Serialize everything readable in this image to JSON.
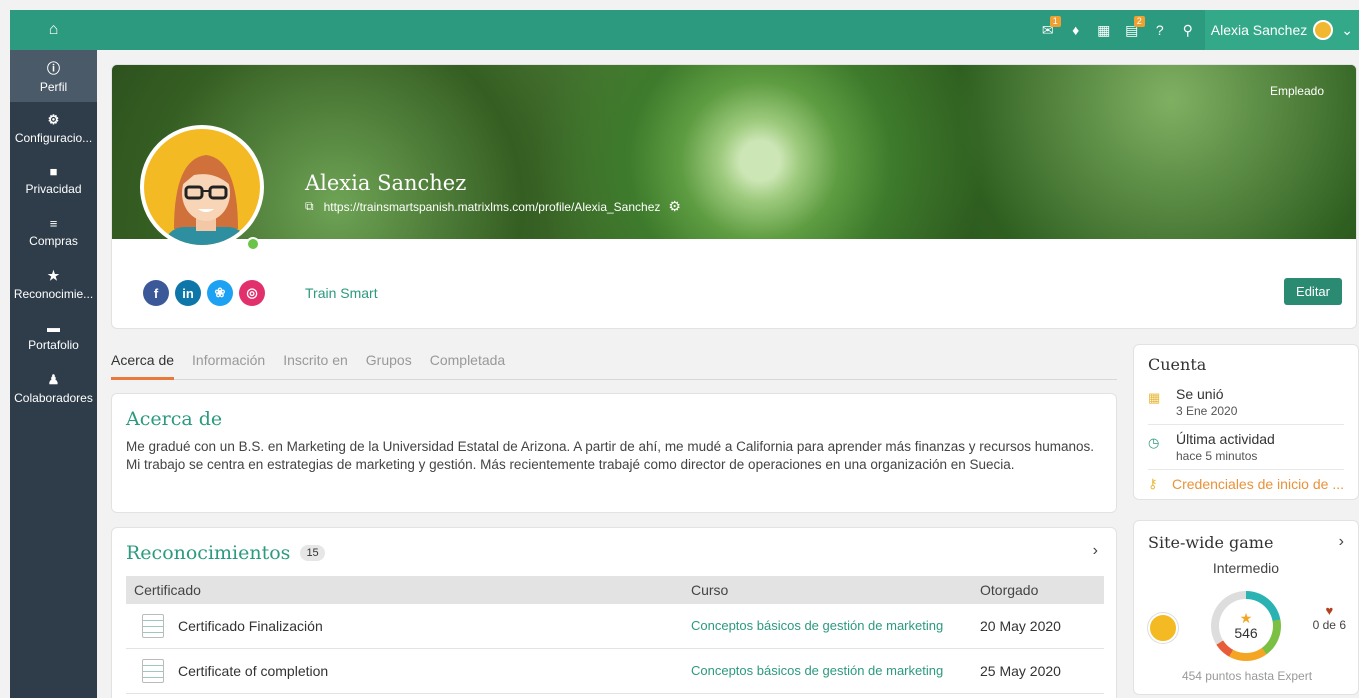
{
  "topbar": {
    "user_name": "Alexia Sanchez",
    "badges": {
      "inbox": "1",
      "cart": "2"
    }
  },
  "sidebar": {
    "items": [
      {
        "label": "Perfil",
        "icon": "info-icon"
      },
      {
        "label": "Configuracio...",
        "icon": "gear-icon"
      },
      {
        "label": "Privacidad",
        "icon": "lock-icon"
      },
      {
        "label": "Compras",
        "icon": "receipt-icon"
      },
      {
        "label": "Reconocimie...",
        "icon": "star-icon"
      },
      {
        "label": "Portafolio",
        "icon": "folder-icon"
      },
      {
        "label": "Colaboradores",
        "icon": "users-icon"
      }
    ]
  },
  "profile": {
    "cover_tag": "Empleado",
    "name": "Alexia Sanchez",
    "url": "https://trainsmartspanish.matrixlms.com/profile/Alexia_Sanchez",
    "organization": "Train Smart",
    "edit_label": "Editar"
  },
  "tabs": [
    "Acerca de",
    "Información",
    "Inscrito en",
    "Grupos",
    "Completada"
  ],
  "about": {
    "title": "Acerca de",
    "text": "Me gradué con un B.S. en Marketing de la Universidad Estatal de Arizona. A partir de ahí, me mudé a California para aprender más finanzas y recursos humanos. Mi trabajo se centra en estrategias de marketing y gestión. Más recientemente trabajé como director de operaciones en una organización en Suecia."
  },
  "recognitions": {
    "title": "Reconocimientos",
    "count": "15",
    "columns": [
      "Certificado",
      "Curso",
      "Otorgado"
    ],
    "rows": [
      {
        "certificate": "Certificado Finalización",
        "course": "Conceptos básicos de gestión de marketing",
        "date": "20 May 2020"
      },
      {
        "certificate": "Certificate of completion",
        "course": "Conceptos básicos de gestión de marketing",
        "date": "25 May 2020"
      }
    ]
  },
  "account": {
    "title": "Cuenta",
    "joined_label": "Se unió",
    "joined_value": "3 Ene 2020",
    "activity_label": "Última actividad",
    "activity_value": "hace 5 minutos",
    "credentials_link": "Credenciales de inicio de ..."
  },
  "game": {
    "title": "Site-wide game",
    "level": "Intermedio",
    "points": "546",
    "badges": "0 de 6",
    "to_next": "454 puntos hasta Expert"
  },
  "colors": {
    "brand": "#2b9a7e",
    "sidebar": "#2f3d4a",
    "accent": "#e8793a"
  }
}
